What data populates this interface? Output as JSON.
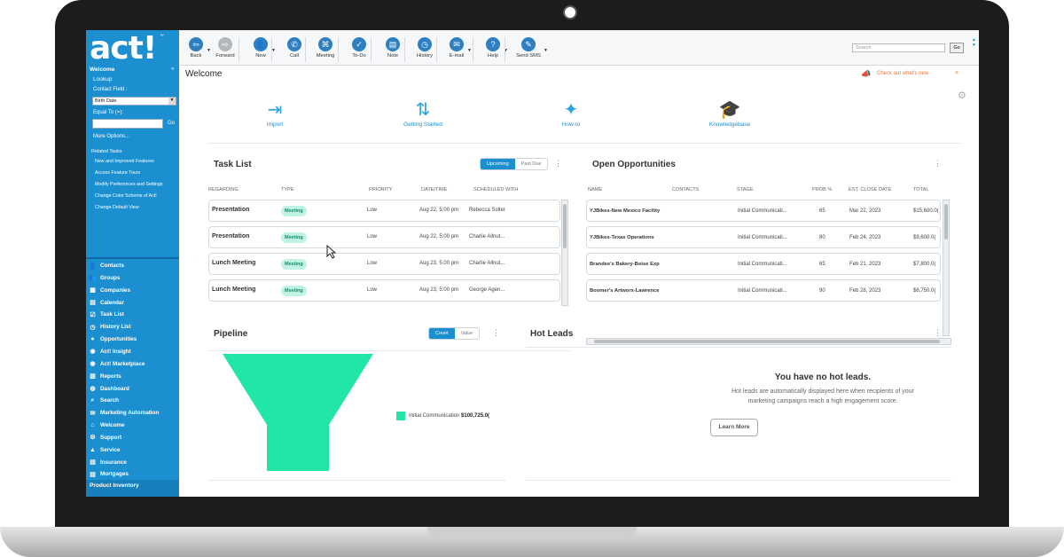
{
  "sidebar": {
    "logo": "act!",
    "logo_tm": "™",
    "header": "Welcome",
    "collapse": "«",
    "lookup": "Lookup",
    "contact_field_label": "Contact Field :",
    "contact_field_value": "Birth Date",
    "equal_to_label": "Equal To (=):",
    "go": "Go",
    "more_options": "More Options...",
    "related_tasks": "Related Tasks",
    "tasks": [
      "New and Improved Features",
      "Access Feature Tours",
      "Modify Preferences and Settings",
      "Change Color Scheme of Act!",
      "Change Default View"
    ],
    "nav": [
      {
        "label": "Contacts",
        "icon": "person-icon",
        "glyph": "👤"
      },
      {
        "label": "Groups",
        "icon": "group-icon",
        "glyph": "👥"
      },
      {
        "label": "Companies",
        "icon": "building-icon",
        "glyph": "▦"
      },
      {
        "label": "Calendar",
        "icon": "calendar-icon",
        "glyph": "▤"
      },
      {
        "label": "Task List",
        "icon": "checklist-icon",
        "glyph": "☑"
      },
      {
        "label": "History List",
        "icon": "history-icon",
        "glyph": "◷"
      },
      {
        "label": "Opportunities",
        "icon": "opportunity-icon",
        "glyph": "●"
      },
      {
        "label": "Act! Insight",
        "icon": "insight-icon",
        "glyph": "◉"
      },
      {
        "label": "Act! Marketplace",
        "icon": "marketplace-icon",
        "glyph": "◉"
      },
      {
        "label": "Reports",
        "icon": "report-icon",
        "glyph": "▥"
      },
      {
        "label": "Dashboard",
        "icon": "dashboard-icon",
        "glyph": "◍"
      },
      {
        "label": "Search",
        "icon": "search-icon",
        "glyph": "⌕"
      },
      {
        "label": "Marketing Automation",
        "icon": "marketing-icon",
        "glyph": "✉"
      },
      {
        "label": "Welcome",
        "icon": "home-icon",
        "glyph": "⌂"
      },
      {
        "label": "Support",
        "icon": "support-icon",
        "glyph": "⚙"
      },
      {
        "label": "Service",
        "icon": "service-icon",
        "glyph": "▲"
      },
      {
        "label": "Insurance",
        "icon": "insurance-icon",
        "glyph": "▤"
      },
      {
        "label": "Mortgages",
        "icon": "mortgage-icon",
        "glyph": "▤"
      }
    ],
    "last_item": "Product Inventory"
  },
  "toolbar": {
    "buttons": [
      {
        "label": "Back",
        "icon": "back-icon",
        "glyph": "⇦",
        "color": "#2d7fc1"
      },
      {
        "label": "Forward",
        "icon": "forward-icon",
        "glyph": "⇨",
        "color": "#b5b8bb"
      },
      {
        "label": "New",
        "icon": "new-contact-icon",
        "glyph": "👤",
        "color": "#2d7fc1"
      },
      {
        "label": "Call",
        "icon": "phone-icon",
        "glyph": "✆",
        "color": "#2d7fc1"
      },
      {
        "label": "Meeting",
        "icon": "meeting-icon",
        "glyph": "⌘",
        "color": "#2d7fc1"
      },
      {
        "label": "To-Do",
        "icon": "todo-icon",
        "glyph": "✓",
        "color": "#2d7fc1"
      },
      {
        "label": "Note",
        "icon": "note-icon",
        "glyph": "▤",
        "color": "#2d7fc1"
      },
      {
        "label": "History",
        "icon": "history-icon",
        "glyph": "◷",
        "color": "#2d7fc1"
      },
      {
        "label": "E-mail",
        "icon": "email-icon",
        "glyph": "✉",
        "color": "#2d7fc1"
      },
      {
        "label": "Help",
        "icon": "help-icon",
        "glyph": "?",
        "color": "#2d7fc1"
      },
      {
        "label": "Send SMS",
        "icon": "sms-icon",
        "glyph": "✎",
        "color": "#2d7fc1"
      }
    ],
    "search_placeholder": "Search",
    "search_go": "Go"
  },
  "main": {
    "title": "Welcome",
    "whats_new": "Check out what's new",
    "close": "×",
    "quick_links": [
      {
        "label": "Import",
        "icon": "import-icon",
        "glyph": "⇥"
      },
      {
        "label": "Getting Started",
        "icon": "directions-icon",
        "glyph": "⇅"
      },
      {
        "label": "How-to",
        "icon": "lightbulb-icon",
        "glyph": "✦"
      },
      {
        "label": "Knowledgebase",
        "icon": "graduation-cap-icon",
        "glyph": "🎓"
      }
    ]
  },
  "task_list": {
    "title": "Task List",
    "toggle": [
      "Upcoming",
      "Past Due"
    ],
    "columns": [
      "REGARDING",
      "TYPE",
      "PRIORITY",
      "DATE/TIME",
      "SCHEDULED WITH"
    ],
    "rows": [
      {
        "regarding": "Presentation",
        "type": "Meeting",
        "priority": "Low",
        "datetime": "Aug 22, 5:00 pm",
        "with": "Rebecca Solter"
      },
      {
        "regarding": "Presentation",
        "type": "Meeting",
        "priority": "Low",
        "datetime": "Aug 22, 5:00 pm",
        "with": "Charlie Allnut..."
      },
      {
        "regarding": "Lunch Meeting",
        "type": "Meeting",
        "priority": "Low",
        "datetime": "Aug 23, 5:00 pm",
        "with": "Charlie Allnut..."
      },
      {
        "regarding": "Lunch Meeting",
        "type": "Meeting",
        "priority": "Low",
        "datetime": "Aug 23, 5:00 pm",
        "with": "George Agen..."
      }
    ]
  },
  "opportunities": {
    "title": "Open Opportunities",
    "columns": [
      "NAME",
      "CONTACTS",
      "STAGE",
      "PROB %",
      "EST. CLOSE DATE",
      "TOTAL"
    ],
    "rows": [
      {
        "name": "YJBikes-New Mexico Facility",
        "stage": "Initial Communicati...",
        "prob": "65",
        "close": "Mar 22, 2023",
        "total": "$15,600.0("
      },
      {
        "name": "YJBikes-Texas Operations",
        "stage": "Initial Communicati...",
        "prob": "80",
        "close": "Feb 24, 2023",
        "total": "$9,600.0("
      },
      {
        "name": "Brandee's Bakery-Boise Exp",
        "stage": "Initial Communicati...",
        "prob": "65",
        "close": "Feb 21, 2023",
        "total": "$7,800.0("
      },
      {
        "name": "Boomer's Artworx-Lawrence",
        "stage": "Initial Communicati...",
        "prob": "90",
        "close": "Feb 28, 2023",
        "total": "$6,750.0("
      }
    ]
  },
  "pipeline": {
    "title": "Pipeline",
    "toggle": [
      "Count",
      "Value"
    ],
    "legend_label": "Initial Communication",
    "legend_value": "$100,725.0(",
    "funnel_color": "#22e6a8"
  },
  "hot_leads": {
    "title": "Hot Leads",
    "heading": "You have no hot leads.",
    "text_line1": "Hot leads are automatically displayed here when recipients of your",
    "text_line2": "marketing campaigns reach a high engagement score.",
    "button": "Learn More"
  },
  "colors": {
    "sidebar": "#1b8fd0",
    "accent": "#1b8fd0",
    "badge": "#bff3e4",
    "funnel": "#22e6a8",
    "whats_new": "#e8763c"
  }
}
